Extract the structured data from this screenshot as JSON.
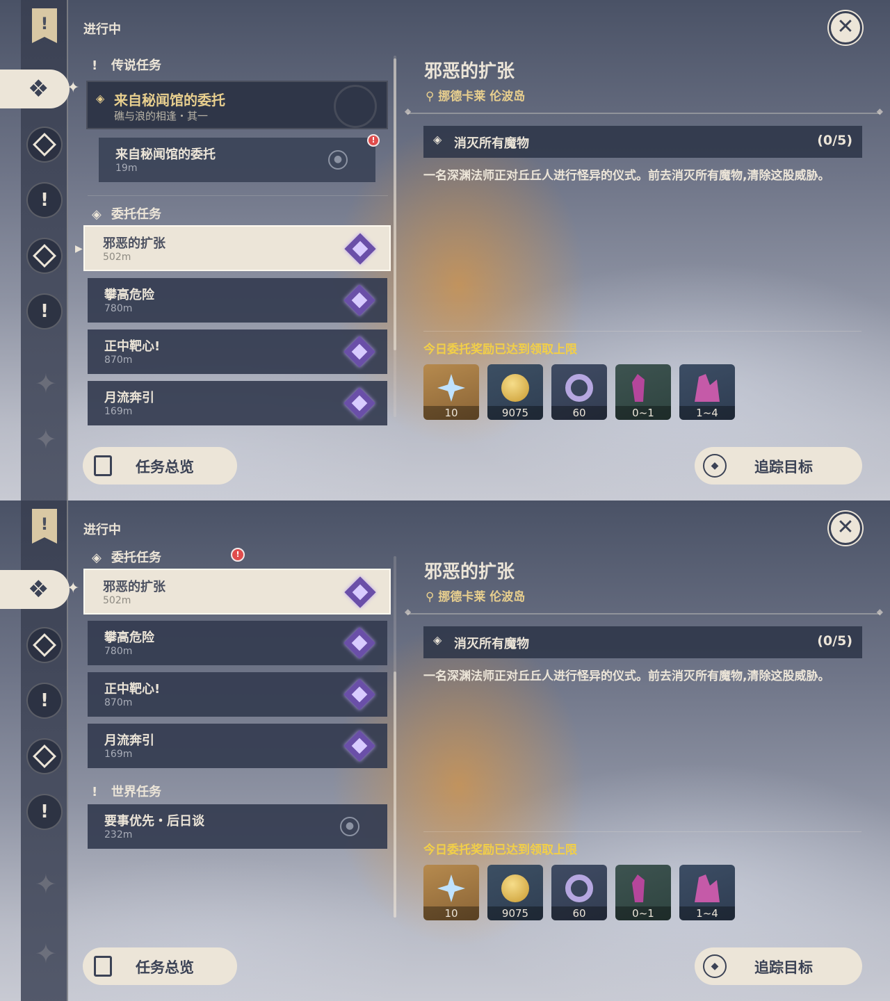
{
  "header": {
    "progress_title": "进行中"
  },
  "sections": {
    "legend": "传说任务",
    "commission": "委托任务",
    "world": "世界任务"
  },
  "legend_quest": {
    "title": "来自秘闻馆的委托",
    "subtitle": "礁与浪的相逢・其一",
    "step_title": "来自秘闻馆的委托",
    "step_distance": "19m"
  },
  "commissions": [
    {
      "title": "邪恶的扩张",
      "distance": "502m"
    },
    {
      "title": "攀高危险",
      "distance": "780m"
    },
    {
      "title": "正中靶心!",
      "distance": "870m"
    },
    {
      "title": "月流奔引",
      "distance": "169m"
    }
  ],
  "world_quest": {
    "title": "要事优先・后日谈",
    "distance": "232m"
  },
  "detail": {
    "title": "邪恶的扩张",
    "location": "挪德卡莱 伦波岛",
    "objective": "消灭所有魔物",
    "objective_count": "(0/5)",
    "description": "一名深渊法师正对丘丘人进行怪异的仪式。前去消灭所有魔物,清除这股威胁。",
    "reward_note": "今日委托奖励已达到领取上限",
    "rewards": [
      {
        "icon": "primogem-icon",
        "count": "10"
      },
      {
        "icon": "mora-icon",
        "count": "9075"
      },
      {
        "icon": "companionship-exp-icon",
        "count": "60"
      },
      {
        "icon": "ore-icon",
        "count": "0~1"
      },
      {
        "icon": "crystal-ore-icon",
        "count": "1~4"
      }
    ]
  },
  "buttons": {
    "overview": "任务总览",
    "track": "追踪目标"
  },
  "colors": {
    "accent_gold": "#e8cf8e",
    "note_yellow": "#f2cf48",
    "cream": "#ece5d8",
    "alert_red": "#e04c4c"
  }
}
